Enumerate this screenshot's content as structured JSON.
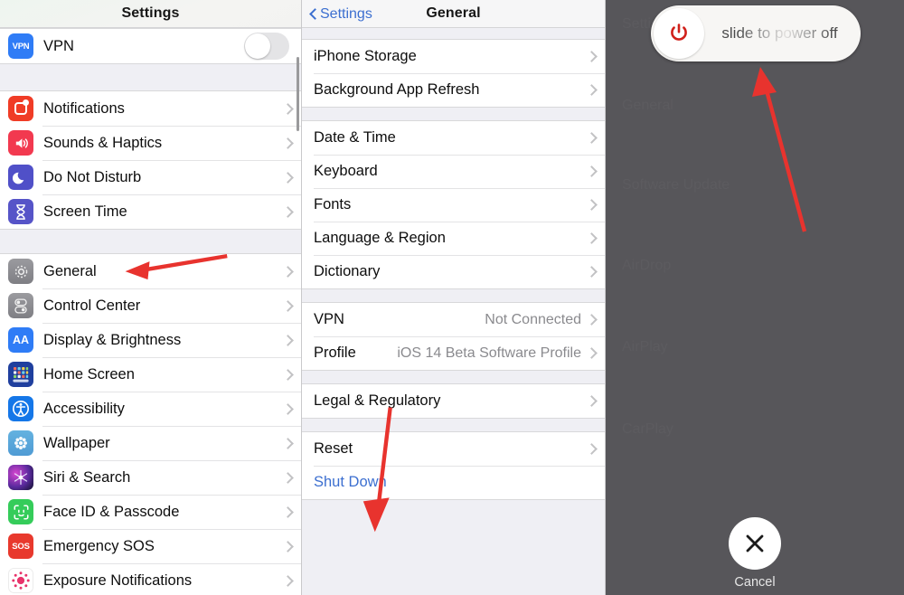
{
  "colors": {
    "accent_blue": "#3c6fd0",
    "annotation_red": "#e8332e",
    "list_bg": "#ffffff",
    "group_bg": "#efeff4",
    "dim_overlay": "#57565a",
    "power_red": "#d0201a"
  },
  "sidebar": {
    "title": "Settings",
    "vpn": {
      "label": "VPN",
      "icon": "vpn-badge-icon",
      "toggle_state": "off"
    },
    "items": [
      {
        "label": "Notifications",
        "icon": "notifications-icon"
      },
      {
        "label": "Sounds & Haptics",
        "icon": "sounds-icon"
      },
      {
        "label": "Do Not Disturb",
        "icon": "moon-icon"
      },
      {
        "label": "Screen Time",
        "icon": "hourglass-icon"
      },
      {
        "label": "General",
        "icon": "gear-icon"
      },
      {
        "label": "Control Center",
        "icon": "toggles-icon"
      },
      {
        "label": "Display & Brightness",
        "icon": "aa-icon"
      },
      {
        "label": "Home Screen",
        "icon": "app-grid-icon"
      },
      {
        "label": "Accessibility",
        "icon": "accessibility-icon"
      },
      {
        "label": "Wallpaper",
        "icon": "flower-icon"
      },
      {
        "label": "Siri & Search",
        "icon": "siri-icon"
      },
      {
        "label": "Face ID & Passcode",
        "icon": "face-id-icon"
      },
      {
        "label": "Emergency SOS",
        "icon": "sos-icon"
      },
      {
        "label": "Exposure Notifications",
        "icon": "exposure-icon"
      }
    ]
  },
  "general": {
    "back_label": "Settings",
    "title": "General",
    "groups": [
      {
        "rows": [
          {
            "label": "iPhone Storage",
            "value": "",
            "accessory": "chevron"
          },
          {
            "label": "Background App Refresh",
            "value": "",
            "accessory": "chevron"
          }
        ]
      },
      {
        "rows": [
          {
            "label": "Date & Time",
            "value": "",
            "accessory": "chevron"
          },
          {
            "label": "Keyboard",
            "value": "",
            "accessory": "chevron"
          },
          {
            "label": "Fonts",
            "value": "",
            "accessory": "chevron"
          },
          {
            "label": "Language & Region",
            "value": "",
            "accessory": "chevron"
          },
          {
            "label": "Dictionary",
            "value": "",
            "accessory": "chevron"
          }
        ]
      },
      {
        "rows": [
          {
            "label": "VPN",
            "value": "Not Connected",
            "accessory": "chevron"
          },
          {
            "label": "Profile",
            "value": "iOS 14 Beta Software Profile",
            "accessory": "chevron"
          }
        ]
      },
      {
        "rows": [
          {
            "label": "Legal & Regulatory",
            "value": "",
            "accessory": "chevron"
          }
        ]
      },
      {
        "rows": [
          {
            "label": "Reset",
            "value": "",
            "accessory": "chevron"
          },
          {
            "label": "Shut Down",
            "value": "",
            "accessory": "none",
            "style": "link"
          }
        ]
      }
    ]
  },
  "power_screen": {
    "slide_label": "slide to power off",
    "power_icon": "power-icon",
    "cancel_label": "Cancel",
    "cancel_icon": "close-icon"
  },
  "annotations": [
    {
      "name": "arrow-to-general",
      "points_to": "General"
    },
    {
      "name": "arrow-to-shut-down",
      "points_to": "Shut Down"
    },
    {
      "name": "arrow-to-slider",
      "points_to": "slide to power off"
    }
  ]
}
